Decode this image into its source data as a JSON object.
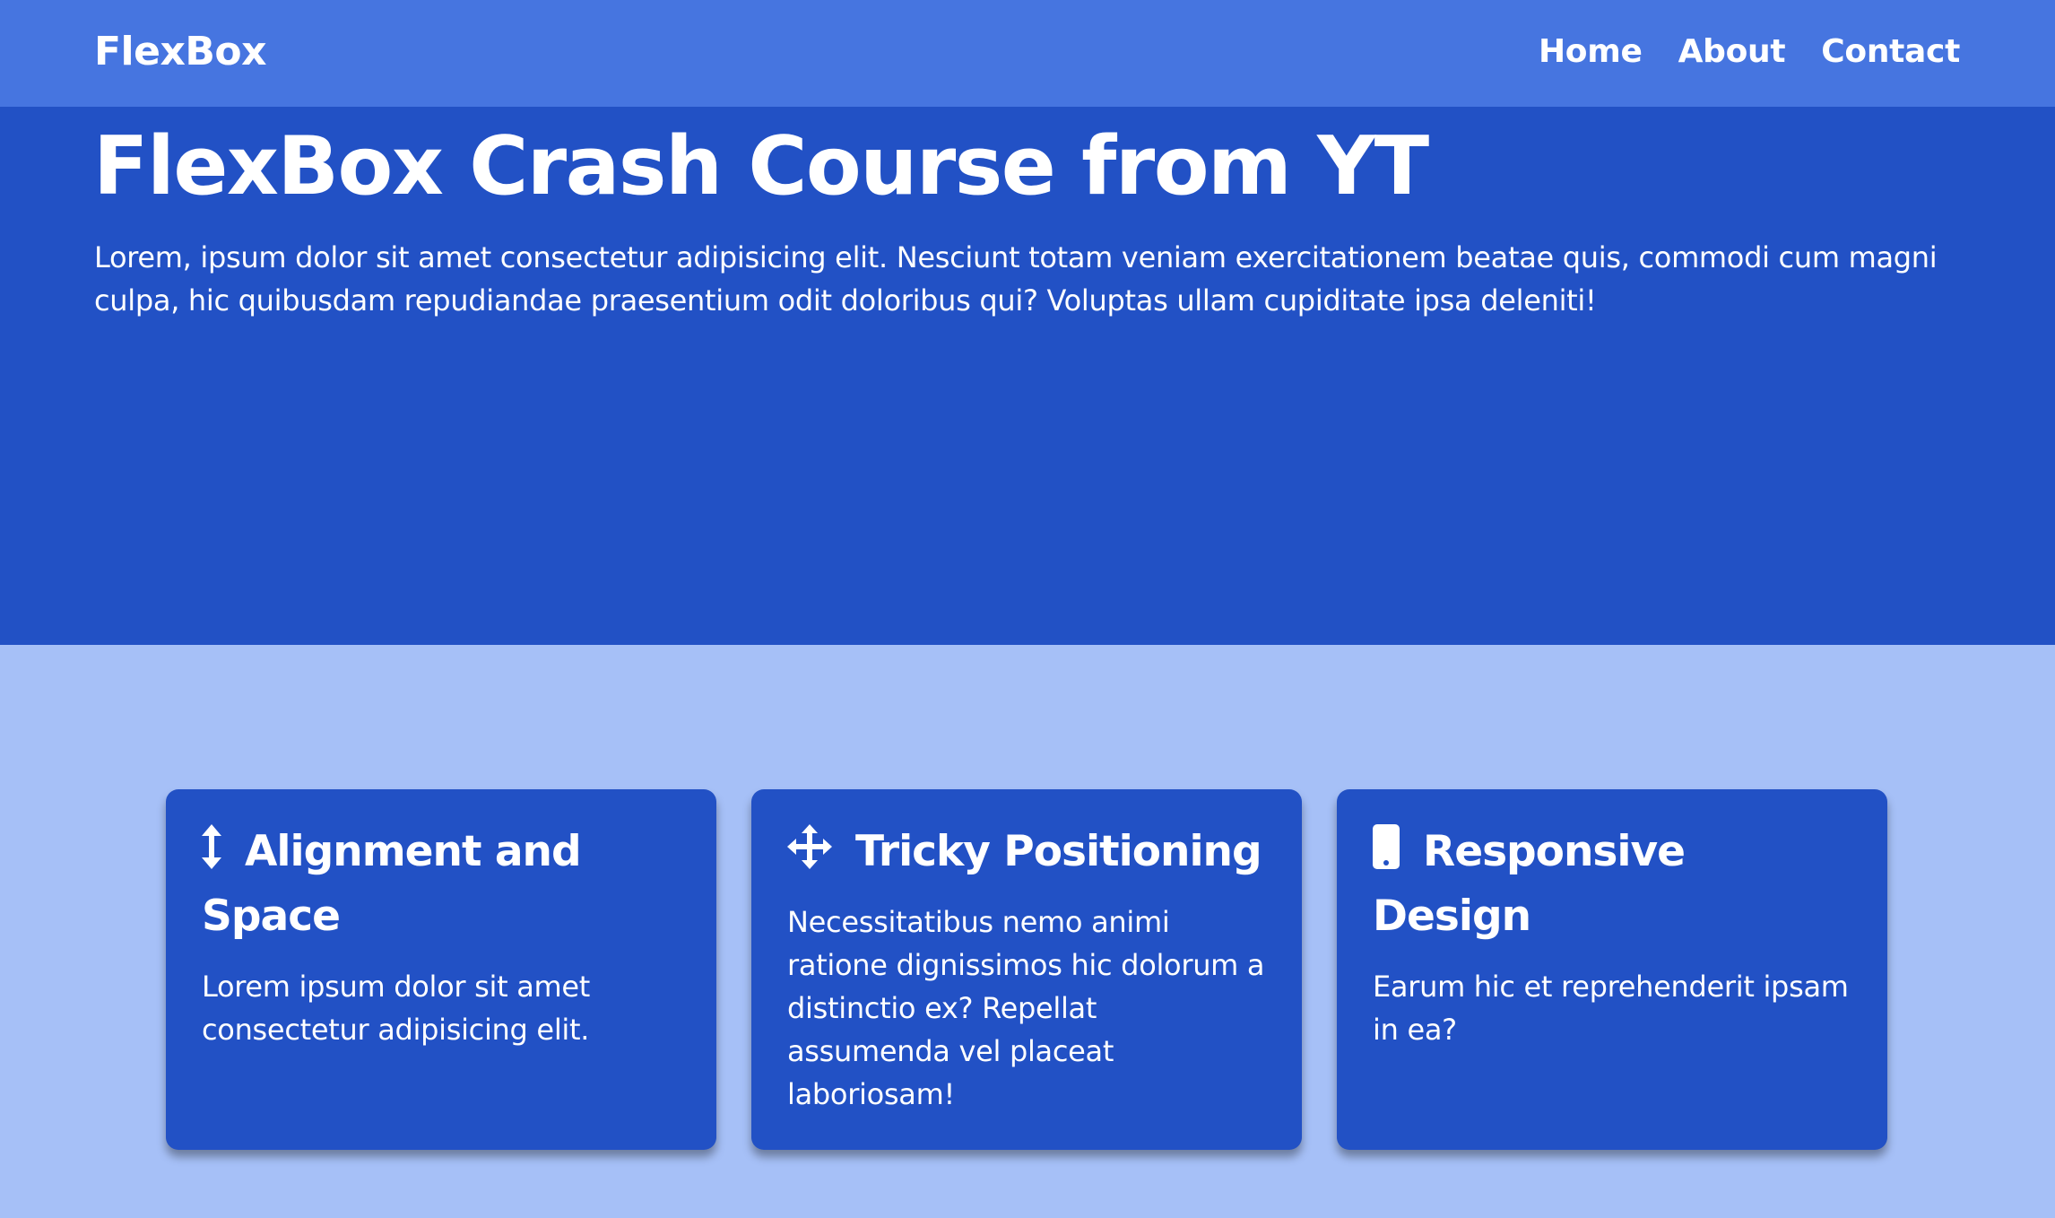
{
  "navbar": {
    "brand": "FlexBox",
    "links": [
      "Home",
      "About",
      "Contact"
    ]
  },
  "hero": {
    "title": "FlexBox Crash Course from YT",
    "text": "Lorem, ipsum dolor sit amet consectetur adipisicing elit. Nesciunt totam veniam exercitationem beatae quis, commodi cum magni culpa, hic quibusdam repudiandae praesentium odit doloribus qui? Voluptas ullam cupiditate ipsa deleniti!"
  },
  "cards": [
    {
      "icon": "vertical-arrows-icon",
      "title": "Alignment and Space",
      "text": "Lorem ipsum dolor sit amet consectetur adipisicing elit."
    },
    {
      "icon": "move-arrows-icon",
      "title": "Tricky Positioning",
      "text": "Necessitatibus nemo animi ratione dignissimos hic dolorum a distinctio ex? Repellat assumenda vel placeat laboriosam!"
    },
    {
      "icon": "mobile-phone-icon",
      "title": "Responsive Design",
      "text": "Earum hic et reprehenderit ipsam in ea?"
    }
  ],
  "colors": {
    "navbar_bg": "#4675e0",
    "hero_bg": "#2251c5",
    "page_bg": "#a6c0f7",
    "card_bg": "#2251c5",
    "text": "#ffffff"
  }
}
